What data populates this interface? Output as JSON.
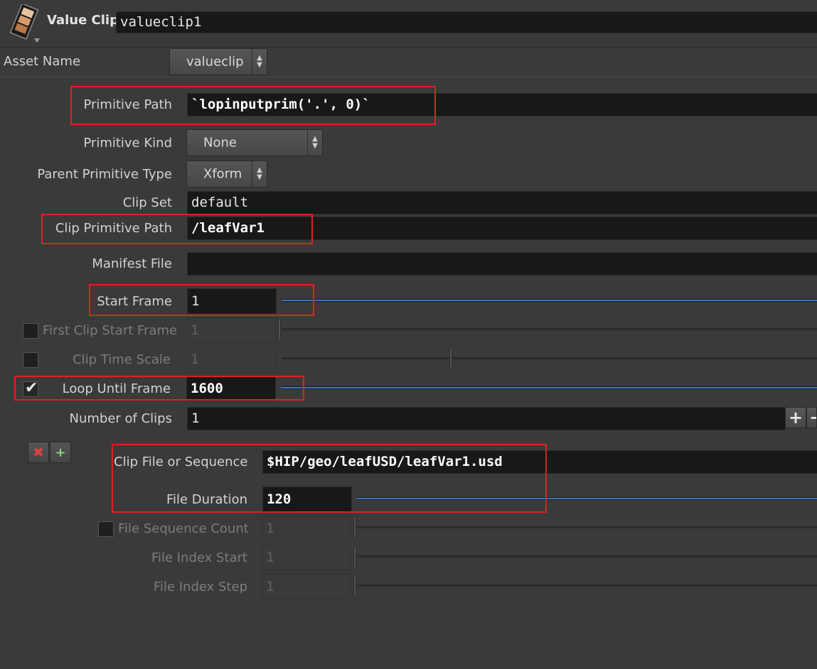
{
  "header": {
    "node_type": "Value Clip",
    "node_name": "valueclip1",
    "icon": "film-strip-icon"
  },
  "asset_name": {
    "label": "Asset Name",
    "value": "valueclip"
  },
  "primitive_path": {
    "label": "Primitive Path",
    "value": "`lopinputprim('.', 0)`"
  },
  "primitive_kind": {
    "label": "Primitive Kind",
    "value": "None"
  },
  "parent_primitive_type": {
    "label": "Parent Primitive Type",
    "value": "Xform"
  },
  "clip_set": {
    "label": "Clip Set",
    "value": "default"
  },
  "clip_primitive_path": {
    "label": "Clip Primitive Path",
    "value": "/leafVar1"
  },
  "manifest_file": {
    "label": "Manifest File",
    "value": ""
  },
  "start_frame": {
    "label": "Start Frame",
    "value": "1"
  },
  "first_clip_start_frame": {
    "label": "First Clip Start Frame",
    "value": "1",
    "enabled": false
  },
  "clip_time_scale": {
    "label": "Clip Time Scale",
    "value": "1",
    "enabled": false
  },
  "loop_until_frame": {
    "label": "Loop Until Frame",
    "value": "1600",
    "enabled": true
  },
  "number_of_clips": {
    "label": "Number of Clips",
    "value": "1"
  },
  "multiparm": {
    "clip_file": {
      "label": "Clip File or Sequence",
      "value": "$HIP/geo/leafUSD/leafVar1.usd"
    },
    "file_duration": {
      "label": "File Duration",
      "value": "120"
    },
    "file_sequence_count": {
      "label": "File Sequence Count",
      "value": "1",
      "enabled": false
    },
    "file_index_start": {
      "label": "File Index Start",
      "value": "1"
    },
    "file_index_step": {
      "label": "File Index Step",
      "value": "1"
    }
  },
  "colors": {
    "highlight": "#e22020",
    "slider_blue": "#3c78c8",
    "remove_icon": "#e04040",
    "insert_icon": "#8fd07a"
  }
}
